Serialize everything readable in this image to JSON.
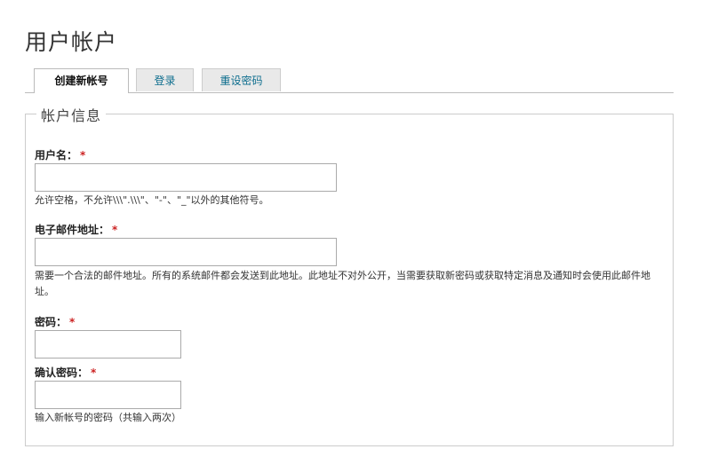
{
  "page": {
    "title": "用户帐户"
  },
  "tabs": [
    {
      "label": "创建新帐号",
      "active": true
    },
    {
      "label": "登录",
      "active": false
    },
    {
      "label": "重设密码",
      "active": false
    }
  ],
  "fieldset": {
    "legend": "帐户信息"
  },
  "fields": {
    "username": {
      "label": "用户名：",
      "required_mark": "*",
      "value": "",
      "description": "允许空格，不允许\\\\\\\".\\\\\\\"、\"-\"、\"_\"以外的其他符号。"
    },
    "email": {
      "label": "电子邮件地址：",
      "required_mark": "*",
      "value": "",
      "description": "需要一个合法的邮件地址。所有的系统邮件都会发送到此地址。此地址不对外公开，当需要获取新密码或获取特定消息及通知时会使用此邮件地址。"
    },
    "password": {
      "label": "密码：",
      "required_mark": "*",
      "value": ""
    },
    "confirm_password": {
      "label": "确认密码：",
      "required_mark": "*",
      "value": "",
      "description": "输入新帐号的密码（共输入两次）"
    }
  },
  "colors": {
    "required": "#cc2222",
    "tab_link": "#0e6e8e",
    "border": "#cccccc"
  }
}
